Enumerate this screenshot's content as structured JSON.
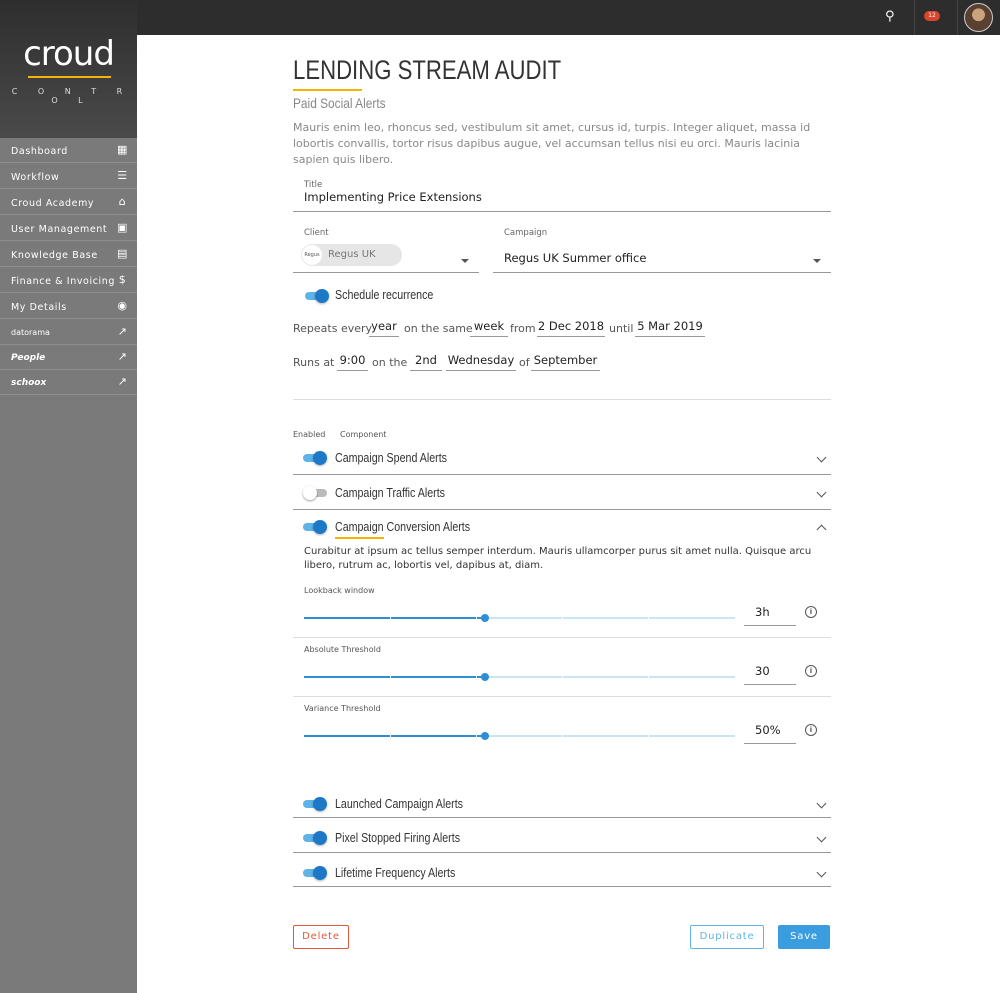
{
  "brand": {
    "name": "croud",
    "tagline": "C O N T R O L",
    "accent": "#f5b400"
  },
  "sidebar": {
    "items": [
      {
        "label": "Dashboard",
        "icon": "dashboard-icon"
      },
      {
        "label": "Workflow",
        "icon": "workflow-icon"
      },
      {
        "label": "Croud Academy",
        "icon": "academy-icon"
      },
      {
        "label": "User Management",
        "icon": "user-management-icon"
      },
      {
        "label": "Knowledge Base",
        "icon": "book-icon"
      },
      {
        "label": "Finance & Invoicing",
        "icon": "dollar-icon"
      },
      {
        "label": "My Details",
        "icon": "profile-icon"
      },
      {
        "label": "datorama",
        "icon": "external-link-icon"
      },
      {
        "label": "People",
        "icon": "external-link-icon"
      },
      {
        "label": "schoox",
        "icon": "external-link-icon"
      }
    ]
  },
  "topbar": {
    "notification_count": "12"
  },
  "page": {
    "title": "LENDING STREAM AUDIT",
    "subtitle": "Paid Social Alerts",
    "description": "Mauris enim leo, rhoncus sed, vestibulum sit amet, cursus id, turpis. Integer aliquet, massa id lobortis convallis, tortor risus dapibus augue, vel accumsan tellus nisi eu orci. Mauris lacinia sapien quis libero."
  },
  "form": {
    "title_label": "Title",
    "title_value": "Implementing Price Extensions",
    "client_label": "Client",
    "client_value": "Regus UK",
    "client_logo_text": "Regus",
    "campaign_label": "Campaign",
    "campaign_value": "Regus UK Summer office",
    "schedule_label": "Schedule recurrence",
    "repeats": {
      "t1": "Repeats every",
      "v1": "year",
      "t2": "on the same",
      "v2": "week",
      "t3": "from",
      "v3": "2 Dec 2018",
      "t4": "until",
      "v4": "5 Mar 2019"
    },
    "runs": {
      "t1": "Runs at",
      "v1": "9:00",
      "t2": "on the",
      "v2": "2nd",
      "v3": "Wednesday",
      "t3": "of",
      "v4": "September"
    }
  },
  "components": {
    "enabled_header": "Enabled",
    "component_header": "Component",
    "items": [
      {
        "label": "Campaign Spend Alerts",
        "enabled": true
      },
      {
        "label": "Campaign Traffic Alerts",
        "enabled": false
      },
      {
        "label": "Campaign Conversion Alerts",
        "enabled": true
      },
      {
        "label": "Launched Campaign Alerts",
        "enabled": true
      },
      {
        "label": "Pixel Stopped Firing Alerts",
        "enabled": true
      },
      {
        "label": "Lifetime Frequency Alerts",
        "enabled": true
      }
    ],
    "expanded_text": "Curabitur at ipsum ac tellus semper interdum. Mauris ullamcorper purus sit amet nulla. Quisque arcu libero, rutrum ac, lobortis vel, dapibus at, diam.",
    "sliders": [
      {
        "label": "Lookback window",
        "value": "3h",
        "level": 0.42
      },
      {
        "label": "Absolute Threshold",
        "value": "30",
        "level": 0.42
      },
      {
        "label": "Variance Threshold",
        "value": "50%",
        "level": 0.42
      }
    ]
  },
  "actions": {
    "delete": "Delete",
    "duplicate": "Duplicate",
    "save": "Save"
  },
  "colors": {
    "primary": "#2d8fd5",
    "danger": "#e0573a",
    "sidebar": "#7a7a7a",
    "topbar": "#2d2d2d"
  }
}
